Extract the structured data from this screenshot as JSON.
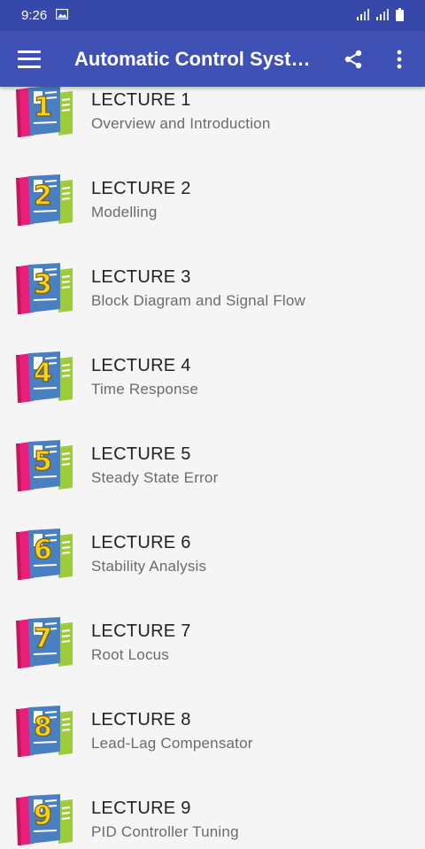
{
  "status": {
    "time": "9:26"
  },
  "app_bar": {
    "title": "Automatic Control Syste…"
  },
  "lectures": [
    {
      "label": "LECTURE 1",
      "subtitle": "Overview and Introduction",
      "number": "1"
    },
    {
      "label": "LECTURE 2",
      "subtitle": "Modelling",
      "number": "2"
    },
    {
      "label": "LECTURE 3",
      "subtitle": "Block Diagram and Signal Flow",
      "number": "3"
    },
    {
      "label": "LECTURE 4",
      "subtitle": "Time Response",
      "number": "4"
    },
    {
      "label": "LECTURE 5",
      "subtitle": "Steady State Error",
      "number": "5"
    },
    {
      "label": "LECTURE 6",
      "subtitle": "Stability Analysis",
      "number": "6"
    },
    {
      "label": "LECTURE 7",
      "subtitle": "Root Locus",
      "number": "7"
    },
    {
      "label": "LECTURE 8",
      "subtitle": "Lead-Lag Compensator",
      "number": "8"
    },
    {
      "label": "LECTURE 9",
      "subtitle": "PID Controller Tuning",
      "number": "9"
    }
  ],
  "colors": {
    "app_bar": "#3f51b5",
    "status_bar": "#3748ab",
    "book_pink": "#e91e78",
    "book_blue": "#4a7fc1",
    "book_green": "#9ccc3c",
    "number_yellow": "#f7d21c"
  }
}
